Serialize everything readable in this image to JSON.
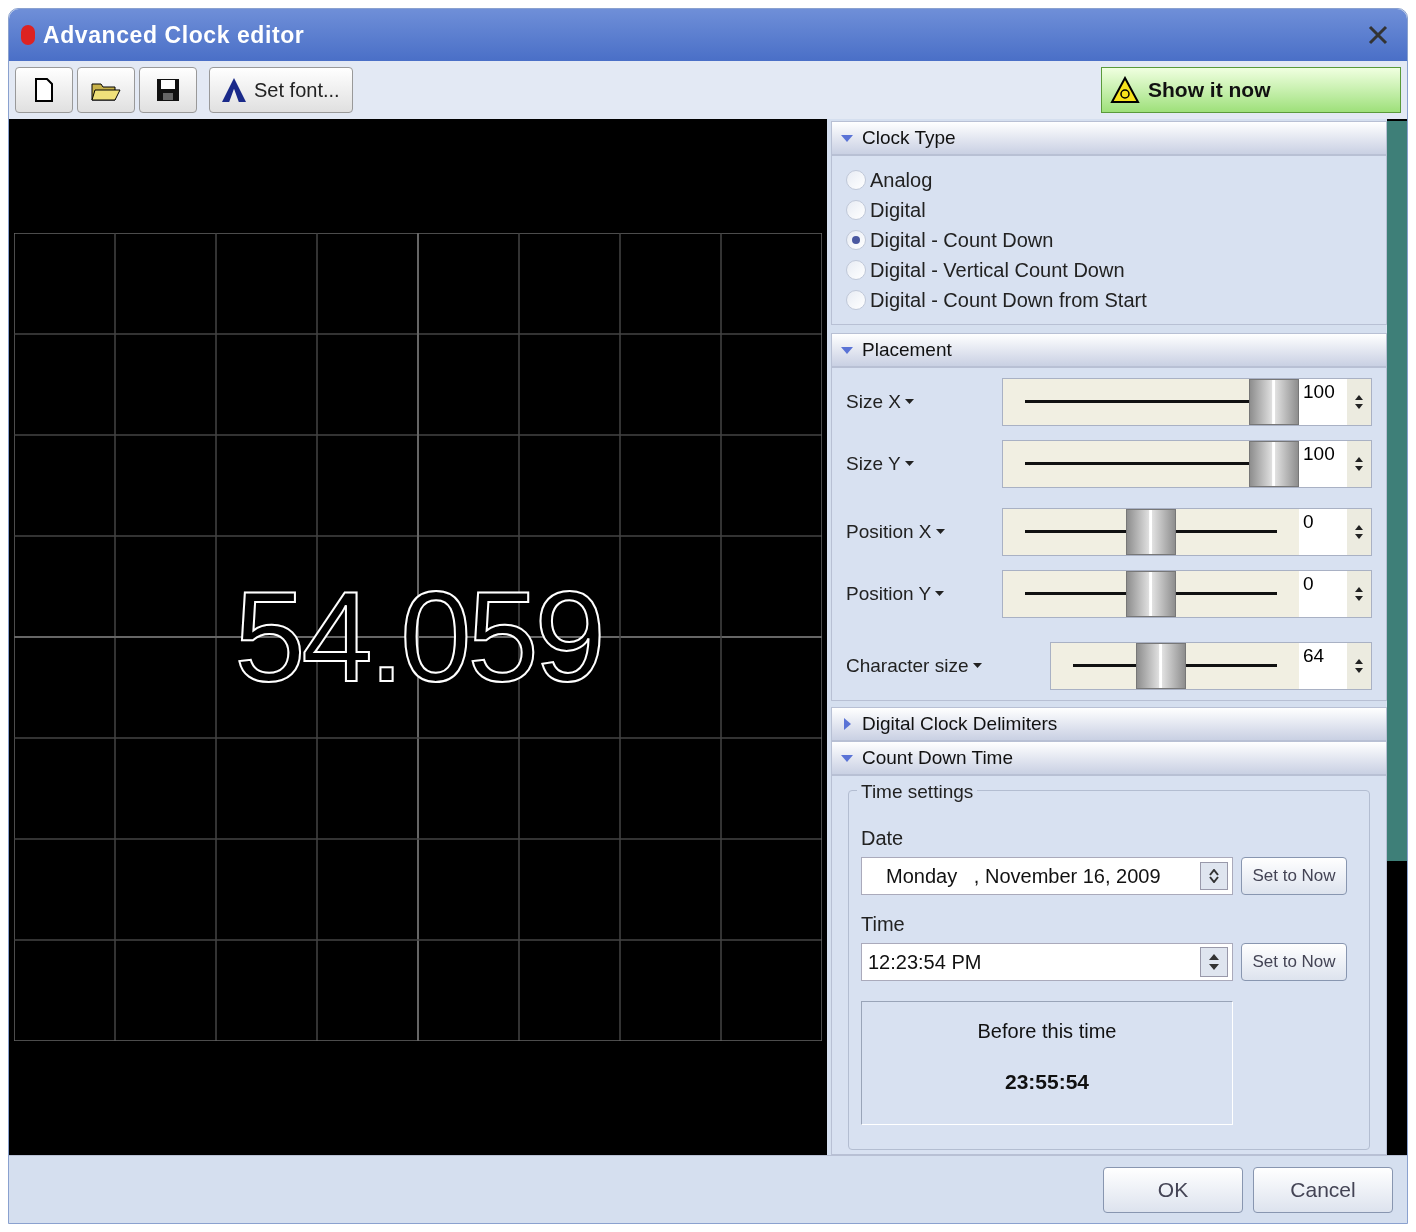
{
  "window": {
    "title": "Advanced Clock editor"
  },
  "toolbar": {
    "set_font_button": "Set font...",
    "show_button": "Show it now"
  },
  "preview": {
    "clock_text": "54.059"
  },
  "clock_type": {
    "title": "Clock Type",
    "expanded": true,
    "options": [
      {
        "label": "Analog",
        "selected": false
      },
      {
        "label": "Digital",
        "selected": false
      },
      {
        "label": "Digital - Count Down",
        "selected": true
      },
      {
        "label": "Digital - Vertical Count Down",
        "selected": false
      },
      {
        "label": "Digital - Count Down from Start",
        "selected": false
      }
    ]
  },
  "placement": {
    "title": "Placement",
    "expanded": true,
    "sliders": [
      {
        "label": "Size X",
        "value": "100",
        "level": 1
      },
      {
        "label": "Size Y",
        "value": "100",
        "level": 1
      },
      {
        "label": "Position X",
        "value": "0",
        "level": 0.5
      },
      {
        "label": "Position Y",
        "value": "0",
        "level": 0.5
      },
      {
        "label": "Character size",
        "value": "64",
        "level": 0.43
      }
    ]
  },
  "delimiters": {
    "title": "Digital Clock Delimiters",
    "expanded": false
  },
  "count_down_time": {
    "title": "Count Down Time",
    "expanded": true,
    "group_title": "Time settings",
    "date_label": "Date",
    "date_value": "Monday   , November 16, 2009",
    "date_button": "Set to Now",
    "time_label": "Time",
    "time_value": "12:23:54 PM",
    "time_button": "Set to Now",
    "info_label": "Before this time",
    "info_value": "23:55:54"
  },
  "buttons": [
    "OK",
    "Cancel"
  ]
}
